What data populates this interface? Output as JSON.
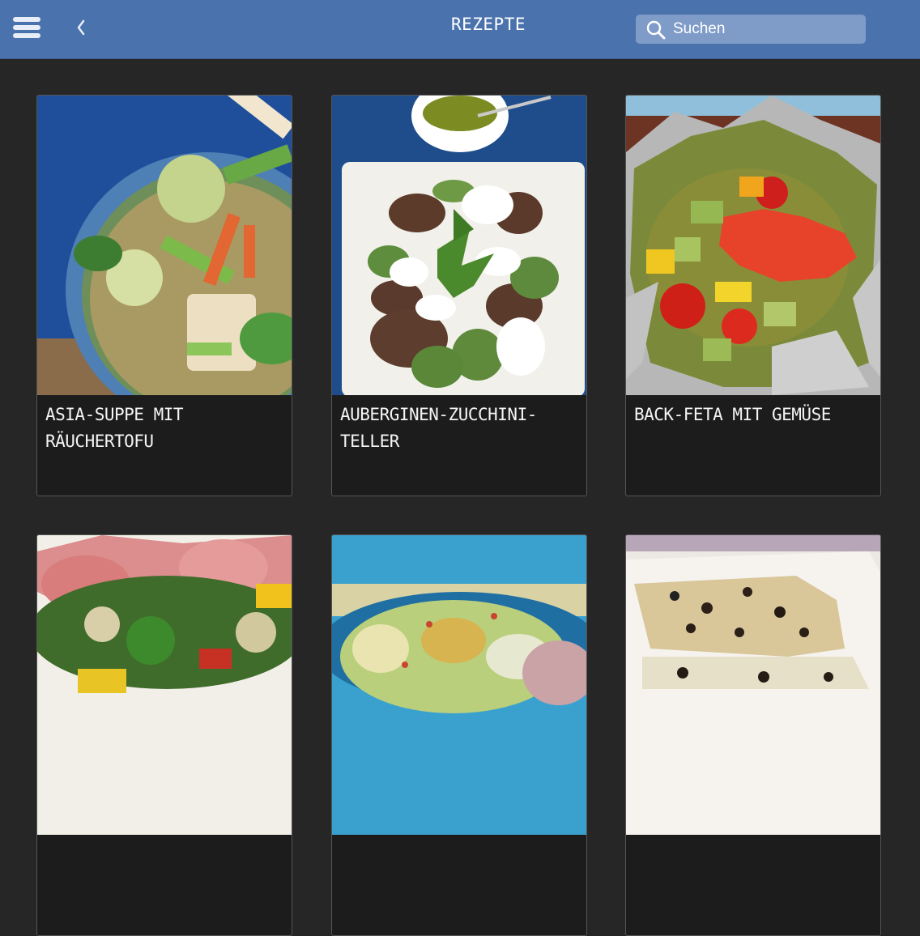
{
  "header": {
    "title": "REZEPTE",
    "search_placeholder": "Suchen"
  },
  "recipes": [
    {
      "title": "Asia-Suppe mit Räuchertofu"
    },
    {
      "title": "Auberginen-Zucchini-Teller"
    },
    {
      "title": "Back-Feta mit Gemüse"
    },
    {
      "title": ""
    },
    {
      "title": ""
    },
    {
      "title": ""
    }
  ],
  "icons": {
    "menu": "hamburger-menu-icon",
    "back": "chevron-left-icon",
    "search": "search-icon"
  },
  "colors": {
    "header_bg": "#4a72ad",
    "search_bg": "#7f9cc8",
    "page_bg": "#262626",
    "card_bg": "#1c1c1c"
  }
}
